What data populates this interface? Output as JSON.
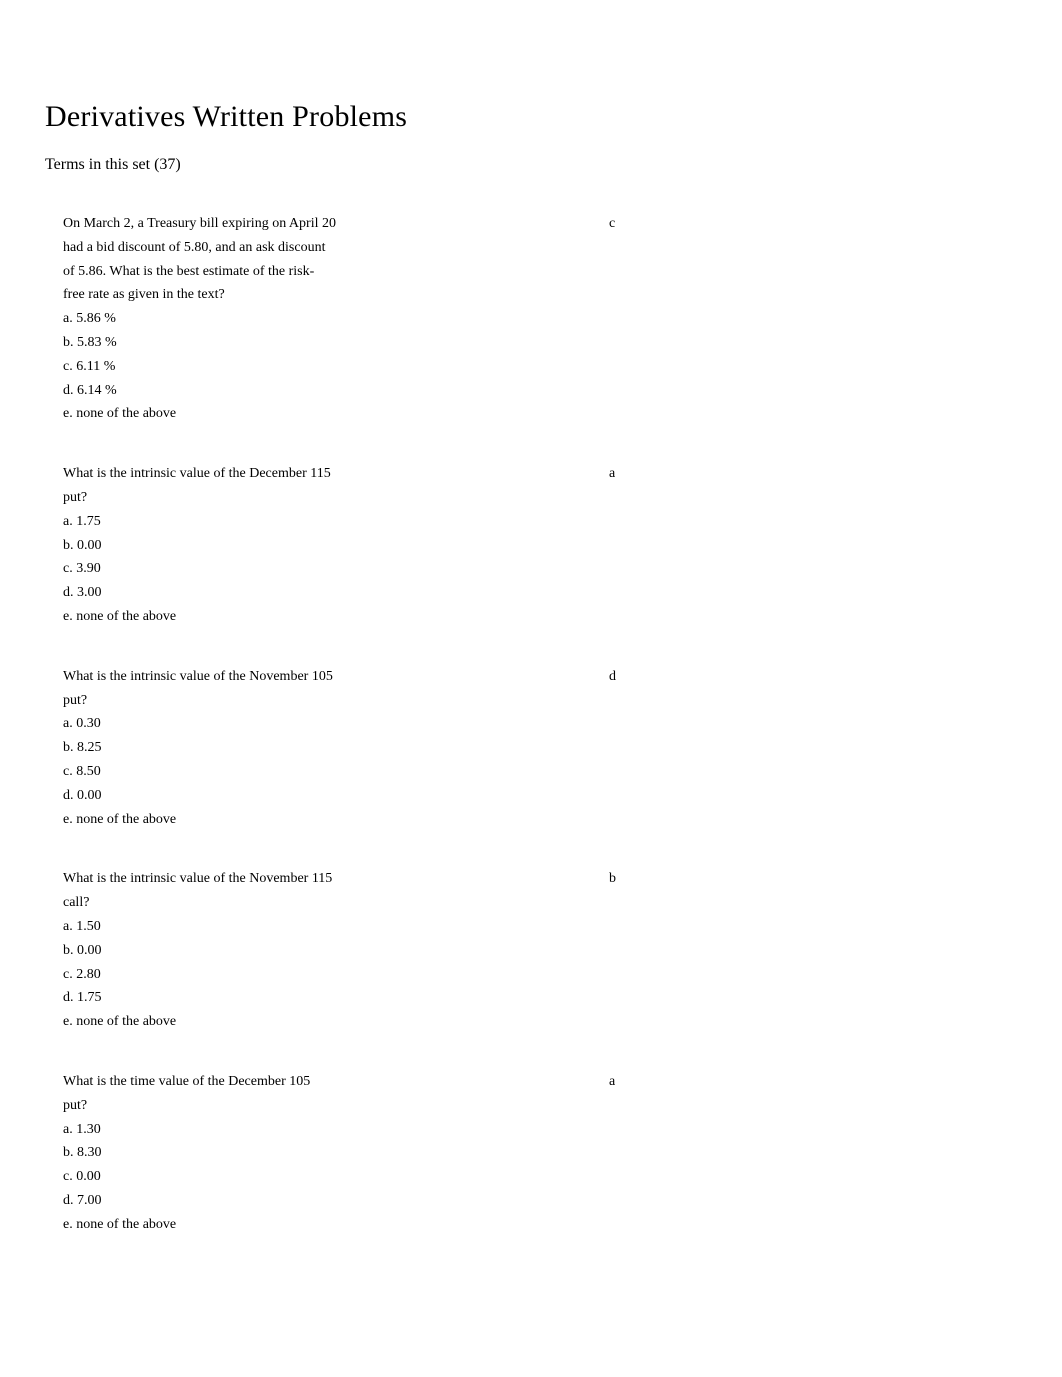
{
  "title": "Derivatives Written Problems",
  "subtitle": "Terms in this set (37)",
  "cards": [
    {
      "term": [
        "On March 2, a Treasury bill expiring on April 20",
        "had a bid discount of 5.80, and an ask discount",
        "of 5.86. What is the best estimate of the risk-",
        "free rate as given in the text?",
        "a. 5.86 %",
        "b. 5.83 %",
        "c. 6.11 %",
        "d. 6.14 %",
        "e. none of the above"
      ],
      "answer": "c"
    },
    {
      "term": [
        "What is the intrinsic value of the December 115",
        "put?",
        "a. 1.75",
        "b. 0.00",
        "c. 3.90",
        "d. 3.00",
        "e. none of the above"
      ],
      "answer": "a"
    },
    {
      "term": [
        "What is the intrinsic value of the November 105",
        "put?",
        "a. 0.30",
        "b. 8.25",
        "c. 8.50",
        "d. 0.00",
        "e. none of the above"
      ],
      "answer": "d"
    },
    {
      "term": [
        "What is the intrinsic value of the November 115",
        "call?",
        "a. 1.50",
        "b. 0.00",
        "c. 2.80",
        "d. 1.75",
        "e. none of the above"
      ],
      "answer": "b"
    },
    {
      "term": [
        "What is the time value of the December 105",
        "put?",
        "a. 1.30",
        "b. 8.30",
        "c. 0.00",
        "d. 7.00",
        "e. none of the above"
      ],
      "answer": "a"
    }
  ]
}
